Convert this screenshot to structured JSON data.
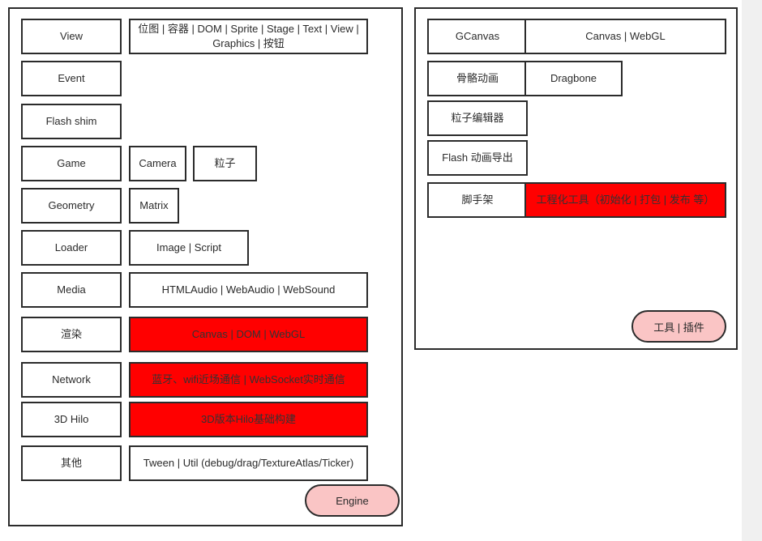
{
  "diagram": {
    "title": "Hilo Engine & Tools Architecture",
    "colors": {
      "border": "#2b2b2b",
      "highlight_red": "#ff0000",
      "pill_pink": "#fac5c5",
      "background": "#ffffff",
      "page_edge": "#f0f0f0"
    }
  },
  "engine_panel": {
    "badge": "Engine",
    "rows": [
      {
        "name": "View",
        "detail": "位图 | 容器 | DOM | Sprite | Stage | Text | View | Graphics | 按钮",
        "highlight": false
      },
      {
        "name": "Event",
        "detail": "",
        "highlight": false
      },
      {
        "name": "Flash shim",
        "detail": "",
        "highlight": false
      },
      {
        "name": "Game",
        "detail": "Camera",
        "detail2": "粒子",
        "highlight": false
      },
      {
        "name": "Geometry",
        "detail": "Matrix",
        "highlight": false
      },
      {
        "name": "Loader",
        "detail": "Image |  Script",
        "highlight": false
      },
      {
        "name": "Media",
        "detail": "HTMLAudio | WebAudio | WebSound",
        "highlight": false
      },
      {
        "name": "渲染",
        "detail": "Canvas | DOM | WebGL",
        "highlight": true
      },
      {
        "name": "Network",
        "detail": "蓝牙、wifi近场通信 | WebSocket实时通信",
        "highlight": true
      },
      {
        "name": "3D Hilo",
        "detail": "3D版本Hilo基础构建",
        "highlight": true
      },
      {
        "name": "其他",
        "detail": "Tween | Util (debug/drag/TextureAtlas/Ticker)",
        "highlight": false
      }
    ]
  },
  "tools_panel": {
    "badge": "工具 | 插件",
    "rows": [
      {
        "name": "GCanvas",
        "detail": "Canvas | WebGL",
        "highlight": false
      },
      {
        "name": "骨骼动画",
        "detail": "Dragbone",
        "highlight": false
      },
      {
        "name": "粒子编辑器",
        "detail": "",
        "highlight": false
      },
      {
        "name": "Flash 动画导出",
        "detail": "",
        "highlight": false
      },
      {
        "name": "脚手架",
        "detail": "工程化工具（初始化 | 打包 | 发布 等）",
        "highlight": true
      }
    ]
  }
}
